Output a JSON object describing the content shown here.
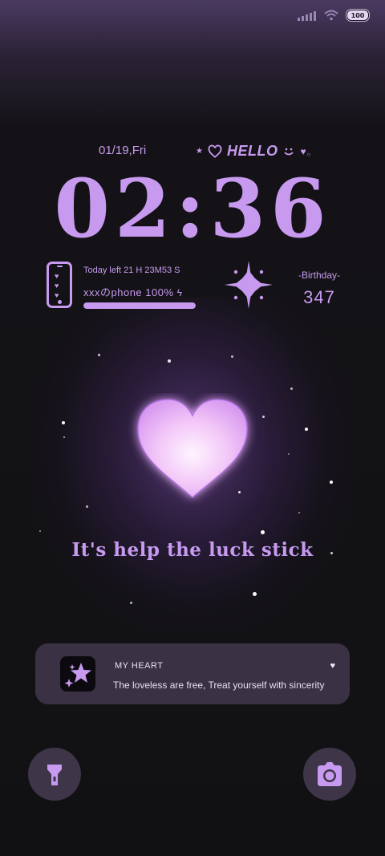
{
  "status_bar": {
    "battery_level": "100",
    "icons": [
      "signal-icon",
      "wifi-icon",
      "battery-icon"
    ]
  },
  "lock": {
    "date": "01/19,Fri",
    "greeting": "HELLO",
    "time": "02:36"
  },
  "phone_widget": {
    "today_left": "Today left 21 H 23M53 S",
    "device": "xxxのphone",
    "battery": "100%",
    "battery_fill": 1.0
  },
  "birthday_widget": {
    "label": "-Birthday-",
    "days": "347"
  },
  "slogan": "It's help the luck stick",
  "notification": {
    "app": "MY HEART",
    "message": "The loveless are free, Treat yourself with sincerity",
    "icon": "sparkle-star-icon"
  },
  "shortcuts": [
    {
      "name": "flashlight",
      "icon": "flashlight-icon"
    },
    {
      "name": "camera",
      "icon": "camera-icon"
    }
  ],
  "colors": {
    "accent": "#c79af0",
    "background": "#111114",
    "card": "#3a3244"
  }
}
